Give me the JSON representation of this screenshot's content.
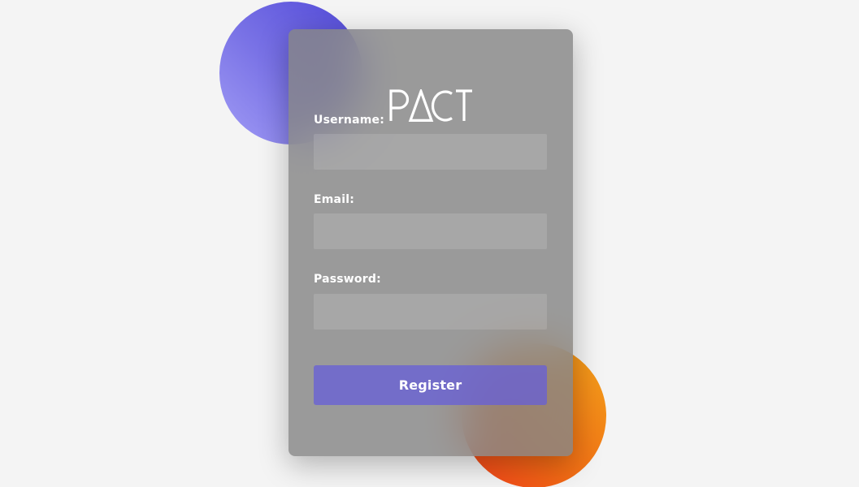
{
  "brand": {
    "logo_text": "PACT",
    "colors": {
      "blob_blue": "#5149d8",
      "blob_orange": "#f3a41b",
      "button": "#6860d6",
      "card": "#868686",
      "background": "#f4f4f4"
    }
  },
  "form": {
    "username": {
      "label": "Username:",
      "value": "",
      "placeholder": ""
    },
    "email": {
      "label": "Email:",
      "value": "",
      "placeholder": ""
    },
    "password": {
      "label": "Password:",
      "value": "",
      "placeholder": ""
    },
    "submit_label": "Register"
  }
}
